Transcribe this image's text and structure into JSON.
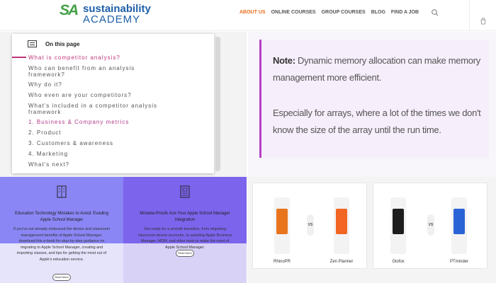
{
  "header": {
    "logo_mark": "SA",
    "logo_line1": "sustainability",
    "logo_line2": "ACADEMY",
    "nav": [
      "ABOUT US",
      "ONLINE COURSES",
      "GROUP COURSES",
      "BLOG",
      "FIND A JOB"
    ],
    "active_nav": "ABOUT US",
    "icons": [
      "search-icon",
      "cart-icon"
    ]
  },
  "toc": {
    "title": "On this page",
    "items": [
      "What is competitor analysis?",
      "Who can benefit from an analysis framework?",
      "Why do it?",
      "Who even are your competitors?",
      "What's included in a competitor analysis framework",
      "1. Business & Company metrics",
      "2. Product",
      "3. Customers & awareness",
      "4. Marketing",
      "What's next?"
    ]
  },
  "note": {
    "label": "Note:",
    "line1": "Dynamic memory allocation can make memory management more efficient.",
    "line2": "Especially for arrays, where a lot of the times we don't know the size of the array until the run time.",
    "accent": "#b63fc4"
  },
  "cards": [
    {
      "title": "Education Technology Mistakes to Avoid: Evading Apple School Manager",
      "desc": "If you've not already embraced the device and classroom management benefits of Apple School Manager, download this e-book for step-by-step guidance on migrating to Apple School Manager, creating and importing classes, and tips for getting the most out of Apple's education service.",
      "button": "Read More",
      "color": "#8a86f5"
    },
    {
      "title": "Mistake-Proofs Ace Your Apple School Manager Integration",
      "desc": "Get ready for a smooth transition, from migrating classroom device accounts, to updating Apple Business Manager, MDM, and other tools to make the most of Apple School Manager.",
      "button": "Read More",
      "color": "#7d64ec"
    }
  ],
  "comparisons": [
    {
      "left": "RhinoPR",
      "vs": "VS",
      "right": "Zen Planner"
    },
    {
      "left": "Glofox",
      "vs": "VS",
      "right": "PTminder"
    }
  ]
}
